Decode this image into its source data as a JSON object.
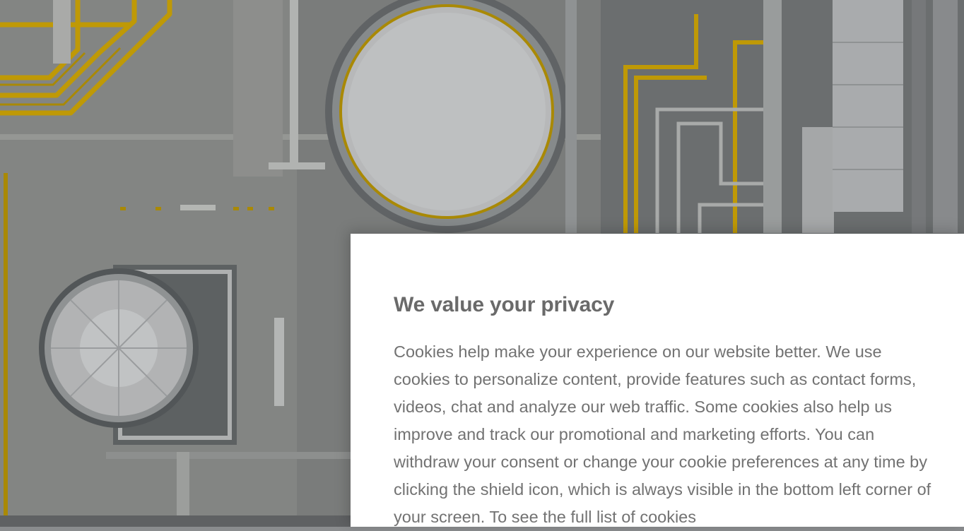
{
  "consent": {
    "title": "We value your privacy",
    "body": "Cookies help make your experience on our website better. We use cookies to personalize content, provide features such as contact forms, videos, chat and analyze our web traffic. Some cookies also help us improve and track our promotional and marketing efforts. You can withdraw your consent or change your cookie preferences at any time by clicking the shield icon, which is always visible in the bottom left corner of your screen. To see the full list of cookies"
  },
  "colors": {
    "pipe_yellow": "#e6b800",
    "tank_white": "#e4e5e6",
    "steel_grey": "#a9abad"
  }
}
